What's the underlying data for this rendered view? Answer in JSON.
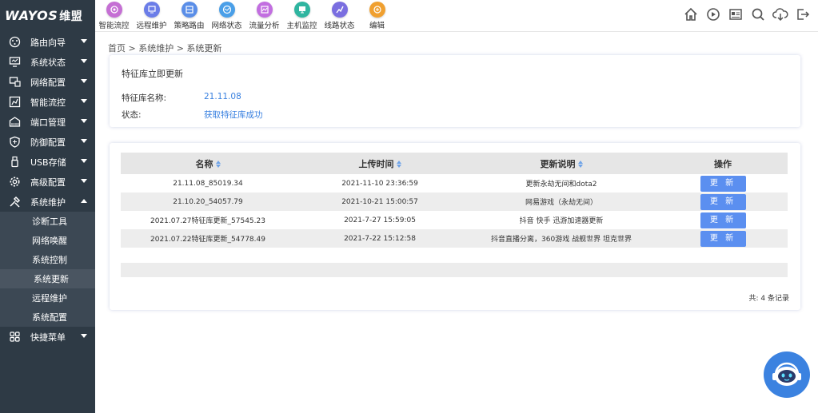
{
  "brand": {
    "logo_text": "WAYOS",
    "logo_cn": "维盟"
  },
  "topnav": [
    {
      "label": "智能流控",
      "icon": "flow-control-icon",
      "color": "#c56fd4"
    },
    {
      "label": "远程维护",
      "icon": "remote-maintenance-icon",
      "color": "#6b7de8"
    },
    {
      "label": "策略路由",
      "icon": "policy-route-icon",
      "color": "#5a8ee8"
    },
    {
      "label": "网络状态",
      "icon": "network-status-icon",
      "color": "#4a9fe8"
    },
    {
      "label": "流量分析",
      "icon": "traffic-analysis-icon",
      "color": "#c26ee0"
    },
    {
      "label": "主机监控",
      "icon": "host-monitor-icon",
      "color": "#2fb5a0"
    },
    {
      "label": "线路状态",
      "icon": "line-status-icon",
      "color": "#7a6ee0"
    },
    {
      "label": "编辑",
      "icon": "edit-icon",
      "color": "#f0a030"
    }
  ],
  "topright_icons": [
    "home-icon",
    "refresh-icon",
    "news-icon",
    "search-icon",
    "download-icon",
    "logout-icon"
  ],
  "sidebar": {
    "items": [
      {
        "label": "路由向导",
        "icon": "wizard-icon"
      },
      {
        "label": "系统状态",
        "icon": "monitor-icon"
      },
      {
        "label": "网络配置",
        "icon": "network-config-icon"
      },
      {
        "label": "智能流控",
        "icon": "chart-icon"
      },
      {
        "label": "端口管理",
        "icon": "port-icon"
      },
      {
        "label": "防御配置",
        "icon": "shield-icon"
      },
      {
        "label": "USB存储",
        "icon": "usb-icon"
      },
      {
        "label": "高级配置",
        "icon": "gear-icon"
      },
      {
        "label": "系统维护",
        "icon": "tools-icon"
      }
    ],
    "subitems": [
      "诊断工具",
      "网络唤醒",
      "系统控制",
      "系统更新",
      "远程维护",
      "系统配置"
    ],
    "last_item": {
      "label": "快捷菜单",
      "icon": "grid-icon"
    }
  },
  "breadcrumb": "首页 > 系统维护 > 系统更新",
  "feature_update": {
    "title": "特征库立即更新",
    "name_label": "特征库名称:",
    "name_value": "21.11.08",
    "status_label": "状态:",
    "status_value": "获取特征库成功"
  },
  "table": {
    "headers": [
      "名称",
      "上传时间",
      "更新说明",
      "操作"
    ],
    "rows": [
      {
        "name": "21.11.08_85019.34",
        "time": "2021-11-10 23:36:59",
        "desc": "更新永劫无间和dota2",
        "action": "更 新"
      },
      {
        "name": "21.10.20_54057.79",
        "time": "2021-10-21 15:00:57",
        "desc": "网易游戏（永劫无间）",
        "action": "更 新"
      },
      {
        "name": "2021.07.27特征库更新_57545.23",
        "time": "2021-7-27 15:59:05",
        "desc": "抖音 快手 迅游加速器更新",
        "action": "更 新"
      },
      {
        "name": "2021.07.22特征库更新_54778.49",
        "time": "2021-7-22 15:12:58",
        "desc": "抖音直播分离，360游戏 战舰世界 坦克世界",
        "action": "更 新"
      }
    ],
    "total": "共: 4 条记录"
  },
  "colors": {
    "sidebar": "#2e3a45",
    "accent": "#3b82e0",
    "button": "#5b8ff0"
  }
}
